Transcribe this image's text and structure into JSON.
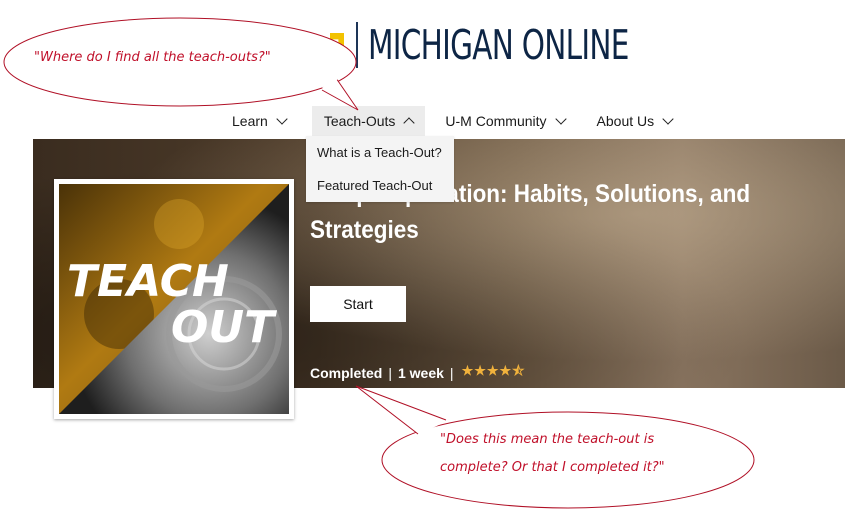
{
  "logo": {
    "text": "MICHIGAN ONLINE",
    "colors": {
      "blue": "#0d2545",
      "maize": "#f2c200"
    }
  },
  "nav": {
    "learn": "Learn",
    "teach_outs": "Teach-Outs",
    "um_community": "U-M Community",
    "about_us": "About Us"
  },
  "dropdown": {
    "item1": "What is a Teach-Out?",
    "item2": "Featured Teach-Out"
  },
  "hero": {
    "title": "Sleep Deprivation: Habits, Solutions, and Strategies",
    "start_label": "Start",
    "status": "Completed",
    "separator": "|",
    "duration": "1 week",
    "rating": 4.5,
    "stars": "★★★★⯪"
  },
  "thumbnail": {
    "line1": "TEACH",
    "line2": "OUT"
  },
  "annotations": {
    "top": "\"Where do I find all the teach-outs?\"",
    "bottom_line1": "\"Does this mean the teach-out is",
    "bottom_line2": "complete? Or that I completed it?\""
  }
}
